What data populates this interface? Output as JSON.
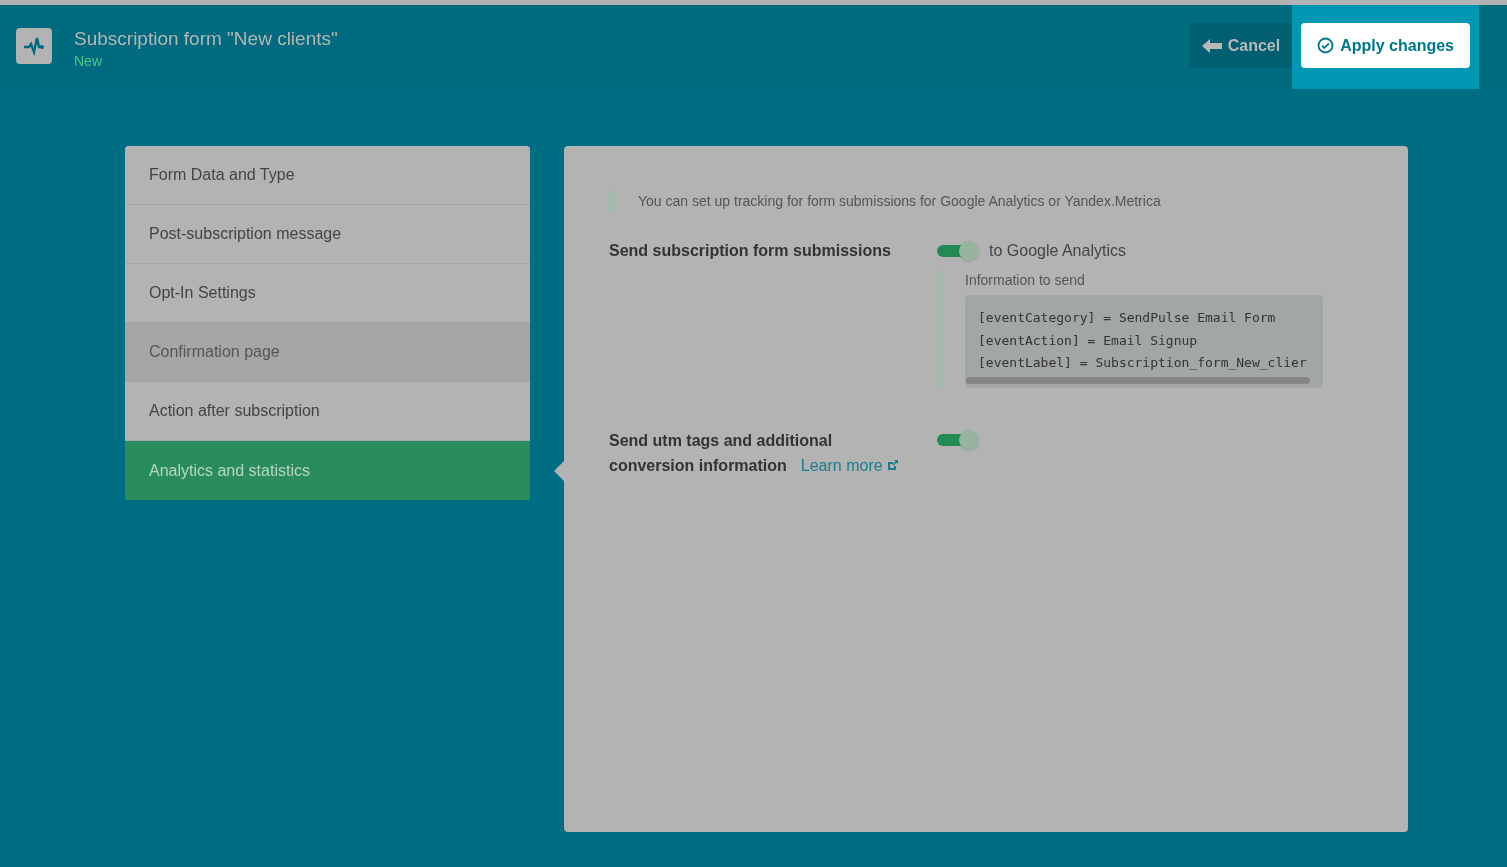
{
  "header": {
    "title": "Subscription form \"New clients\"",
    "status": "New",
    "buttons": [
      {
        "kind": "cancel",
        "label": "Cancel"
      },
      {
        "kind": "apply",
        "label": "Apply changes"
      }
    ]
  },
  "sidebar": {
    "items": [
      {
        "label": "Form Data and Type",
        "selected": false,
        "hovered": false
      },
      {
        "label": "Post-subscription message",
        "selected": false,
        "hovered": false
      },
      {
        "label": "Opt-In Settings",
        "selected": false,
        "hovered": false
      },
      {
        "label": "Confirmation page",
        "selected": false,
        "hovered": true
      },
      {
        "label": "Action after subscription",
        "selected": false,
        "hovered": false
      },
      {
        "label": "Analytics and statistics",
        "selected": true,
        "hovered": false
      }
    ]
  },
  "panel": {
    "note": "You can set up tracking for form submissions for Google Analytics or Yandex.Metrica",
    "settings": [
      {
        "label": "Send subscription form submissions",
        "on": true,
        "toggle_label": "to Google Analytics",
        "details": {
          "title": "Information to send",
          "code_lines": [
            "[eventCategory] = SendPulse Email Form",
            "[eventAction] = Email Signup",
            "[eventLabel] = Subscription_form_New_clier"
          ]
        }
      },
      {
        "label": "Send utm tags and additional conversion information",
        "on": true,
        "link": "Learn more"
      }
    ]
  }
}
